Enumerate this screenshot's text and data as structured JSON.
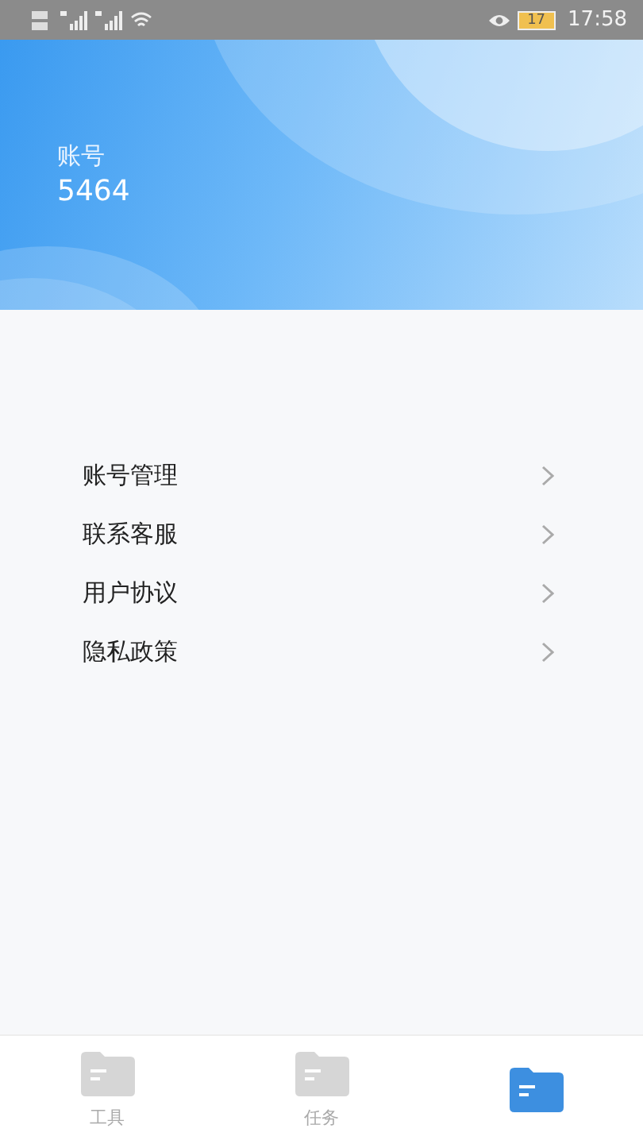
{
  "status_bar": {
    "battery": "17",
    "time": "17:58"
  },
  "header": {
    "label": "账号",
    "account": "5464"
  },
  "menu": [
    {
      "label": "账号管理"
    },
    {
      "label": "联系客服"
    },
    {
      "label": "用户协议"
    },
    {
      "label": "隐私政策"
    }
  ],
  "tab_bar": [
    {
      "label": "工具",
      "selected": false
    },
    {
      "label": "任务",
      "selected": false
    },
    {
      "selected": true
    }
  ]
}
